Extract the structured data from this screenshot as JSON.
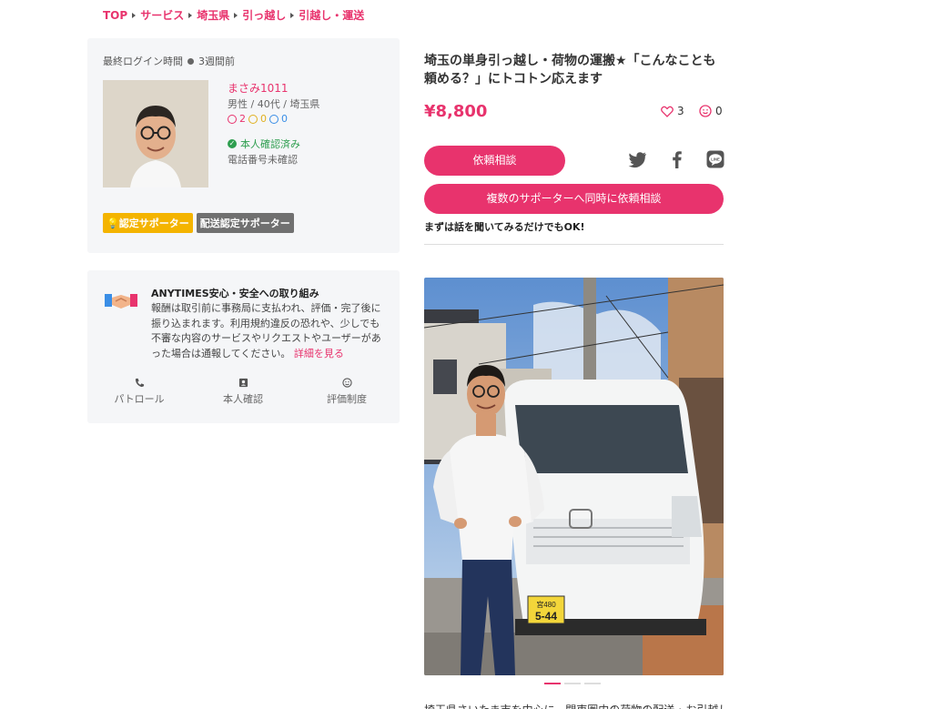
{
  "breadcrumb": [
    "TOP",
    "サービス",
    "埼玉県",
    "引っ越し",
    "引越し・運送"
  ],
  "profile": {
    "last_login_label": "最終ログイン時間",
    "last_login_value": "3週間前",
    "name": "まさみ1011",
    "meta": "男性 / 40代 / 埼玉県",
    "ratings": {
      "good": "2",
      "neutral": "0",
      "bad": "0"
    },
    "verified": "本人確認済み",
    "phone_status": "電話番号未確認",
    "badges": [
      "認定サポーター",
      "配送認定サポーター"
    ]
  },
  "safety": {
    "title": "ANYTIMES安心・安全への取り組み",
    "text": "報酬は取引前に事務局に支払われ、評価・完了後に振り込まれます。利用規約違反の恐れや、少しでも不審な内容のサービスやリクエストやユーザーがあった場合は通報してください。",
    "more": "詳細を見る",
    "links": [
      "パトロール",
      "本人確認",
      "評価制度"
    ]
  },
  "service": {
    "title": "埼玉の単身引っ越し・荷物の運搬★「こんなことも頼める？」にトコトン応えます",
    "price": "¥8,800",
    "likes": "3",
    "smiles": "0",
    "consult_button": "依頼相談",
    "multi_button": "複数のサポーターへ同時に依頼相談",
    "hint": "まずは話を聞いてみるだけでもOK!",
    "plate_top": "宮480",
    "plate_bottom": "5-44",
    "description": "埼玉県さいたま市を中心に、関東圏内の荷物の配送・お引越し"
  },
  "colors": {
    "accent": "#e8336d",
    "verified": "#2e9e4f",
    "badge_yellow": "#f4b400",
    "badge_gray": "#707070"
  }
}
